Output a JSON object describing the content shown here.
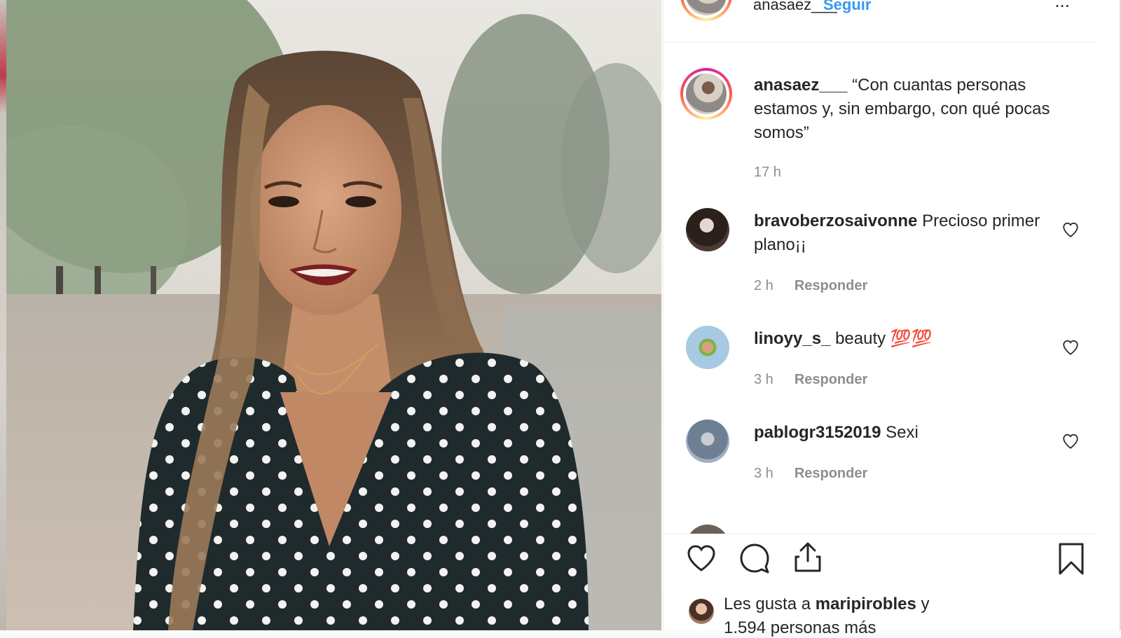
{
  "post": {
    "author": "anasaez___",
    "follow_label": "Seguir",
    "more_label": "...",
    "caption": "“Con cuantas personas estamos y, sin embargo, con qué pocas somos”",
    "caption_time": "17 h"
  },
  "comments": [
    {
      "user": "bravoberzosaivonne",
      "text": "Precioso primer plano¡¡",
      "time": "2 h",
      "reply": "Responder"
    },
    {
      "user": "linoyy_s_",
      "text": "beauty 💯💯",
      "time": "3 h",
      "reply": "Responder"
    },
    {
      "user": "pablogr3152019",
      "text": "Sexi",
      "time": "3 h",
      "reply": "Responder"
    }
  ],
  "likes": {
    "prefix": "Les gusta a",
    "user": "maripirobles",
    "suffix": "y",
    "line2": "1.594 personas más"
  },
  "colors": {
    "link_blue": "#3897f0",
    "muted_gray": "#8e8e8e",
    "text": "#262626"
  },
  "icons": [
    "heart-icon",
    "comment-icon",
    "share-icon",
    "bookmark-icon",
    "small-heart-icon"
  ]
}
